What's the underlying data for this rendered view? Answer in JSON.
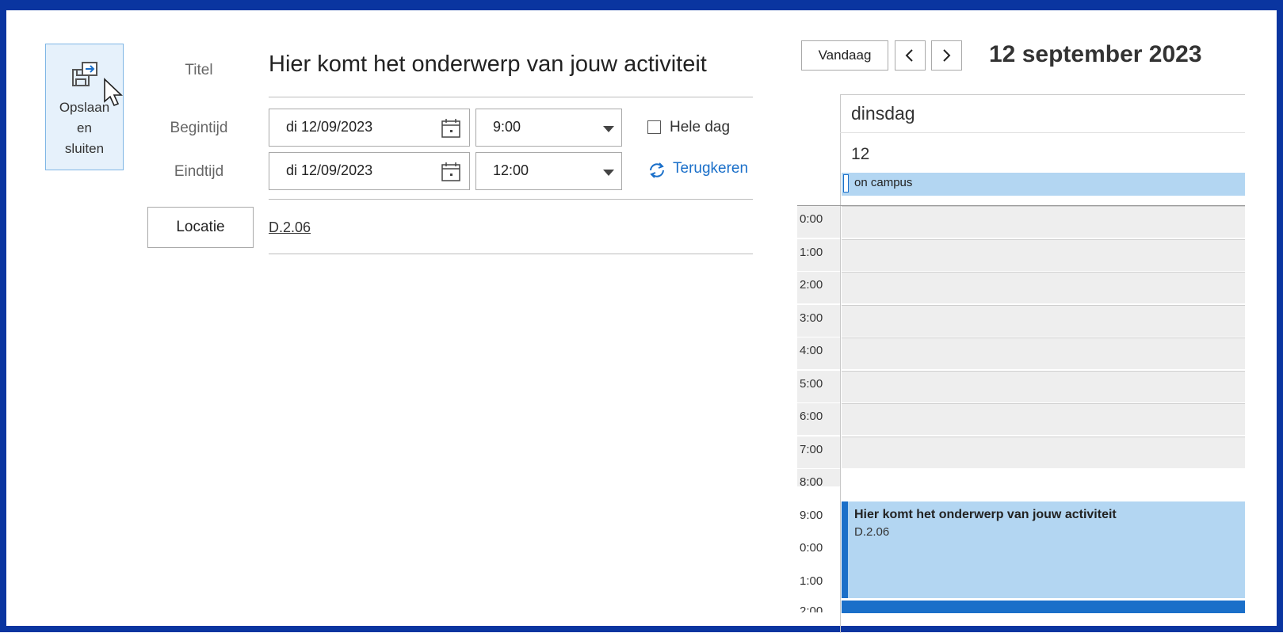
{
  "toolbar": {
    "save_close_label": "Opslaan en sluiten",
    "save_line1": "Opslaan",
    "save_line2": "en",
    "save_line3": "sluiten"
  },
  "form": {
    "title_label": "Titel",
    "title_value": "Hier komt het onderwerp van jouw activiteit",
    "start_label": "Begintijd",
    "start_date": "di 12/09/2023",
    "start_time": "9:00",
    "end_label": "Eindtijd",
    "end_date": "di 12/09/2023",
    "end_time": "12:00",
    "all_day_label": "Hele dag",
    "recurrence_label": "Terugkeren",
    "location_button": "Locatie",
    "location_value": "D.2.06"
  },
  "calendar": {
    "today_button": "Vandaag",
    "prev_icon": "chevron-left-icon",
    "next_icon": "chevron-right-icon",
    "date_heading": "12 september 2023",
    "day_name": "dinsdag",
    "day_number": "12",
    "all_day_event": "on campus",
    "hours": [
      "0:00",
      "1:00",
      "2:00",
      "3:00",
      "4:00",
      "5:00",
      "6:00",
      "7:00",
      "8:00",
      "9:00",
      "0:00",
      "1:00",
      "2:00"
    ],
    "event": {
      "title": "Hier komt het onderwerp van jouw activiteit",
      "location": "D.2.06"
    }
  },
  "colors": {
    "frame": "#0a35a0",
    "accent": "#1a6fc9",
    "event_bg": "#b3d6f2",
    "grid_bg": "#eeeeee"
  }
}
